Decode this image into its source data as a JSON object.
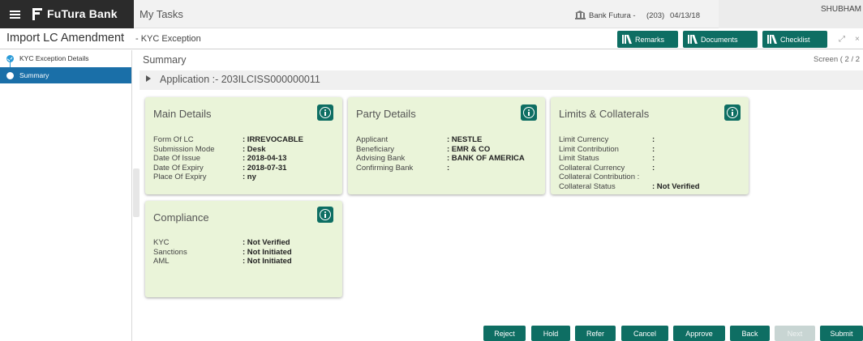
{
  "header": {
    "brand": "FuTura Bank",
    "my_tasks": "My Tasks",
    "bank_name": "Bank Futura -",
    "branch_code": "(203)",
    "date": "04/13/18",
    "user": "SHUBHAM"
  },
  "titlebar": {
    "title": "Import LC Amendment",
    "subtitle": "- KYC Exception",
    "buttons": [
      "Remarks",
      "Documents",
      "Checklist"
    ]
  },
  "sidebar": {
    "items": [
      {
        "label": "KYC Exception Details",
        "status": "done"
      },
      {
        "label": "Summary",
        "status": "current"
      }
    ]
  },
  "main": {
    "section_label": "Summary",
    "screen_indicator": "Screen ( 2 / 2",
    "application": "Application :- 203ILCISS000000011"
  },
  "cards": {
    "main_details": {
      "title": "Main Details",
      "rows": [
        {
          "k": "Form Of LC",
          "v": ": IRREVOCABLE"
        },
        {
          "k": "Submission Mode",
          "v": ": Desk"
        },
        {
          "k": "Date Of Issue",
          "v": ": 2018-04-13"
        },
        {
          "k": "Date Of Expiry",
          "v": ": 2018-07-31"
        },
        {
          "k": "Place Of Expiry",
          "v": ": ny"
        }
      ]
    },
    "party_details": {
      "title": "Party Details",
      "rows": [
        {
          "k": "Applicant",
          "v": ": NESTLE"
        },
        {
          "k": "Beneficiary",
          "v": ": EMR & CO"
        },
        {
          "k": "Advising Bank",
          "v": ": BANK OF AMERICA"
        },
        {
          "k": "Confirming Bank",
          "v": ":"
        }
      ]
    },
    "limits_collaterals": {
      "title": "Limits & Collaterals",
      "rows": [
        {
          "k": "Limit Currency",
          "v": ":"
        },
        {
          "k": "Limit Contribution",
          "v": ":"
        },
        {
          "k": "Limit Status",
          "v": ":"
        },
        {
          "k": "Collateral Currency",
          "v": ":"
        },
        {
          "k": "Collateral Contribution :",
          "v": ""
        },
        {
          "k": "Collateral Status",
          "v": ": Not Verified"
        }
      ]
    },
    "compliance": {
      "title": "Compliance",
      "rows": [
        {
          "k": "KYC",
          "v": ": Not Verified"
        },
        {
          "k": "Sanctions",
          "v": ": Not Initiated"
        },
        {
          "k": "AML",
          "v": ": Not Initiated"
        }
      ]
    }
  },
  "footer": {
    "buttons": [
      {
        "label": "Reject",
        "enabled": true
      },
      {
        "label": "Hold",
        "enabled": true
      },
      {
        "label": "Refer",
        "enabled": true
      },
      {
        "label": "Cancel",
        "enabled": true
      },
      {
        "label": "Approve",
        "enabled": true
      },
      {
        "label": "Back",
        "enabled": true
      },
      {
        "label": "Next",
        "enabled": false
      },
      {
        "label": "Submit",
        "enabled": true
      }
    ]
  },
  "colors": {
    "brand_bg": "#2b2b2b",
    "accent": "#0e6e63",
    "sidebar_active": "#1a6fa8",
    "card_bg": "#eaf4d9"
  }
}
